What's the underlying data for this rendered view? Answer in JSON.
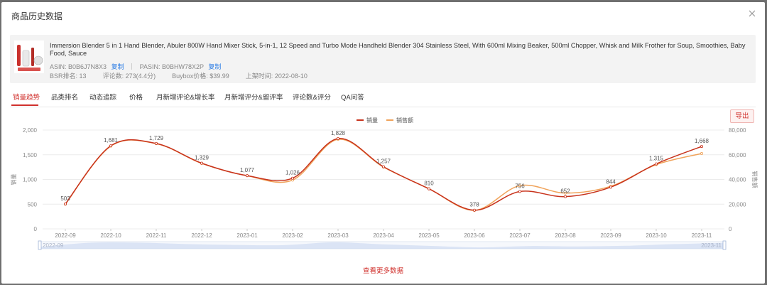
{
  "modal": {
    "title": "商品历史数据",
    "close_icon": "close-icon"
  },
  "product": {
    "title": "Immersion Blender 5 in 1 Hand Blender, Abuler 800W Hand Mixer Stick, 5-in-1, 12 Speed and Turbo Mode Handheld Blender 304 Stainless Steel, With 600ml Mixing Beaker, 500ml Chopper, Whisk and Milk Frother for Soup, Smoothies, Baby Food, Sauce",
    "asin_label": "ASIN:",
    "asin": "B0B6J7N8X3",
    "copy_label": "复制",
    "pasin_label": "PASIN:",
    "pasin": "B0BHW78X2P",
    "bsr_label": "BSR排名:",
    "bsr": "13",
    "reviews_label": "评论数:",
    "reviews": "273(4.4分)",
    "buybox_label": "Buybox价格:",
    "buybox": "$39.99",
    "launch_label": "上架时间:",
    "launch": "2022-08-10"
  },
  "tabs": [
    "销量趋势",
    "品类排名",
    "动态追踪",
    "价格",
    "月新增评论&增长率",
    "月新增评分&留评率",
    "评论数&评分",
    "QA问答"
  ],
  "active_tab": 0,
  "export_label": "导出",
  "more_label": "查看更多数据",
  "colors": {
    "accent": "#d0312d",
    "sales": "#c8331c",
    "revenue": "#f0a35a",
    "zoom": "#c9d7f0"
  },
  "chart_data": {
    "type": "line",
    "categories": [
      "2022-09",
      "2022-10",
      "2022-11",
      "2022-12",
      "2023-01",
      "2023-02",
      "2023-03",
      "2023-04",
      "2023-05",
      "2023-06",
      "2023-07",
      "2023-08",
      "2023-09",
      "2023-10",
      "2023-11"
    ],
    "series": [
      {
        "name": "销量",
        "axis": "left",
        "values": [
          503,
          1681,
          1729,
          1329,
          1077,
          1026,
          1828,
          1257,
          810,
          378,
          756,
          652,
          844,
          1315,
          1668
        ]
      },
      {
        "name": "销售额",
        "axis": "right",
        "values": [
          20000,
          67000,
          69000,
          53000,
          43000,
          39500,
          72500,
          50000,
          32500,
          15000,
          35000,
          29000,
          34500,
          52000,
          61000
        ]
      }
    ],
    "data_labels": [
      "503",
      "1,681",
      "1,729",
      "1,329",
      "1,077",
      "1,026",
      "1,828",
      "1,257",
      "810",
      "378",
      "756",
      "652",
      "844",
      "1,315",
      "1,668"
    ],
    "yticks_left": [
      "0",
      "500",
      "1,000",
      "1,500",
      "2,000"
    ],
    "yticks_right": [
      "0",
      "20,000",
      "40,000",
      "60,000",
      "80,000"
    ],
    "ylim_left": [
      0,
      2000
    ],
    "ylim_right": [
      0,
      80000
    ],
    "ylabel": "销量",
    "ylabel_right": "销售额",
    "legend_position": "top-center",
    "grid": true,
    "zoom_start": "2022-09",
    "zoom_end": "2023-11"
  }
}
